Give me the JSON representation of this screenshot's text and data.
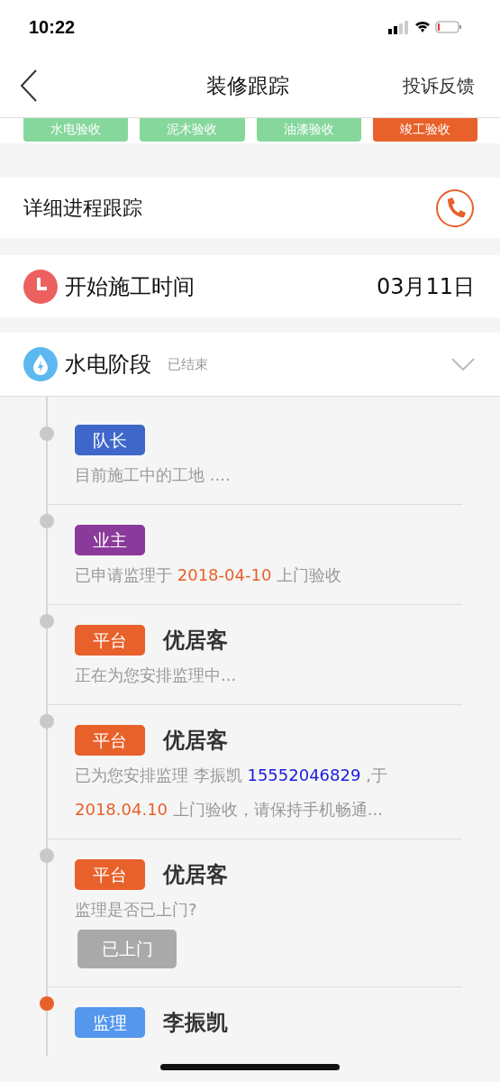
{
  "status_bar": {
    "time": "10:22"
  },
  "nav": {
    "title": "装修跟踪",
    "action": "投诉反馈"
  },
  "stages": [
    {
      "label": "水电验收",
      "kind": "done"
    },
    {
      "label": "泥木验收",
      "kind": "done"
    },
    {
      "label": "油漆验收",
      "kind": "done"
    },
    {
      "label": "竣工验收",
      "kind": "pending"
    }
  ],
  "detail": {
    "title": "详细进程跟踪"
  },
  "start": {
    "label": "开始施工时间",
    "date": "03月11日"
  },
  "phase": {
    "title": "水电阶段",
    "status": "已结束",
    "expanded": true
  },
  "timeline": [
    {
      "tag": "队长",
      "color": "#3f67c9",
      "current": false,
      "lines": [
        [
          {
            "text": "目前施工中的工地 ....",
            "kind": "plain"
          }
        ]
      ]
    },
    {
      "tag": "业主",
      "color": "#8a3a9a",
      "current": false,
      "lines": [
        [
          {
            "text": "已申请监理于 ",
            "kind": "plain"
          },
          {
            "text": "2018-04-10",
            "kind": "date"
          },
          {
            "text": " 上门验收",
            "kind": "plain"
          }
        ]
      ]
    },
    {
      "tag": "平台",
      "color": "#e8602a",
      "name": "优居客",
      "current": false,
      "lines": [
        [
          {
            "text": "正在为您安排监理中...",
            "kind": "plain"
          }
        ]
      ]
    },
    {
      "tag": "平台",
      "color": "#e8602a",
      "name": "优居客",
      "current": false,
      "lines": [
        [
          {
            "text": "已为您安排监理 李振凯 ",
            "kind": "plain"
          },
          {
            "text": "15552046829",
            "kind": "phone"
          },
          {
            "text": " ,于",
            "kind": "plain"
          }
        ],
        [
          {
            "text": "2018.04.10",
            "kind": "date"
          },
          {
            "text": " 上门验收，请保持手机畅通...",
            "kind": "plain"
          }
        ]
      ]
    },
    {
      "tag": "平台",
      "color": "#e8602a",
      "name": "优居客",
      "current": false,
      "lines": [
        [
          {
            "text": "监理是否已上门?",
            "kind": "plain"
          }
        ]
      ],
      "button": {
        "label": "已上门",
        "disabled": true
      }
    },
    {
      "tag": "监理",
      "color": "#5497ec",
      "name": "李振凯",
      "current": true
    }
  ]
}
